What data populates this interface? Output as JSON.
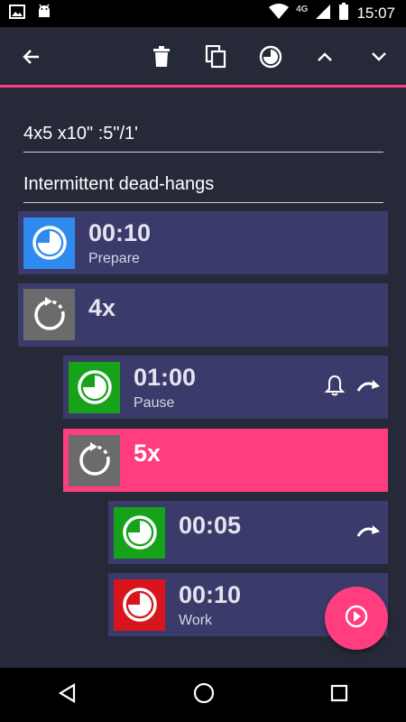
{
  "status_bar": {
    "time": "15:07",
    "network": "4G"
  },
  "toolbar": {
    "icons": [
      "back-arrow-icon",
      "delete-icon",
      "copy-icon",
      "timer-icon",
      "chevron-up-icon",
      "chevron-down-icon"
    ]
  },
  "form": {
    "name": "4x5 x10\" :5\"/1'",
    "description": "Intermittent dead-hangs"
  },
  "items": [
    {
      "value": "00:10",
      "label": "Prepare",
      "color": "#2f8af0"
    },
    {
      "value": "4x",
      "label": ""
    },
    {
      "value": "01:00",
      "label": "Pause",
      "color": "#16a31a",
      "extras": [
        "bell-icon",
        "skip-icon"
      ]
    },
    {
      "value": "5x",
      "label": "",
      "highlight": "#ff3d7f"
    },
    {
      "value": "00:05",
      "label": "",
      "color": "#16a31a",
      "extras": [
        "skip-icon"
      ]
    },
    {
      "value": "00:10",
      "label": "Work",
      "color": "#d8151c"
    }
  ],
  "fab": {
    "icon": "play-icon"
  },
  "nav": [
    "back-icon",
    "home-icon",
    "recents-icon"
  ]
}
